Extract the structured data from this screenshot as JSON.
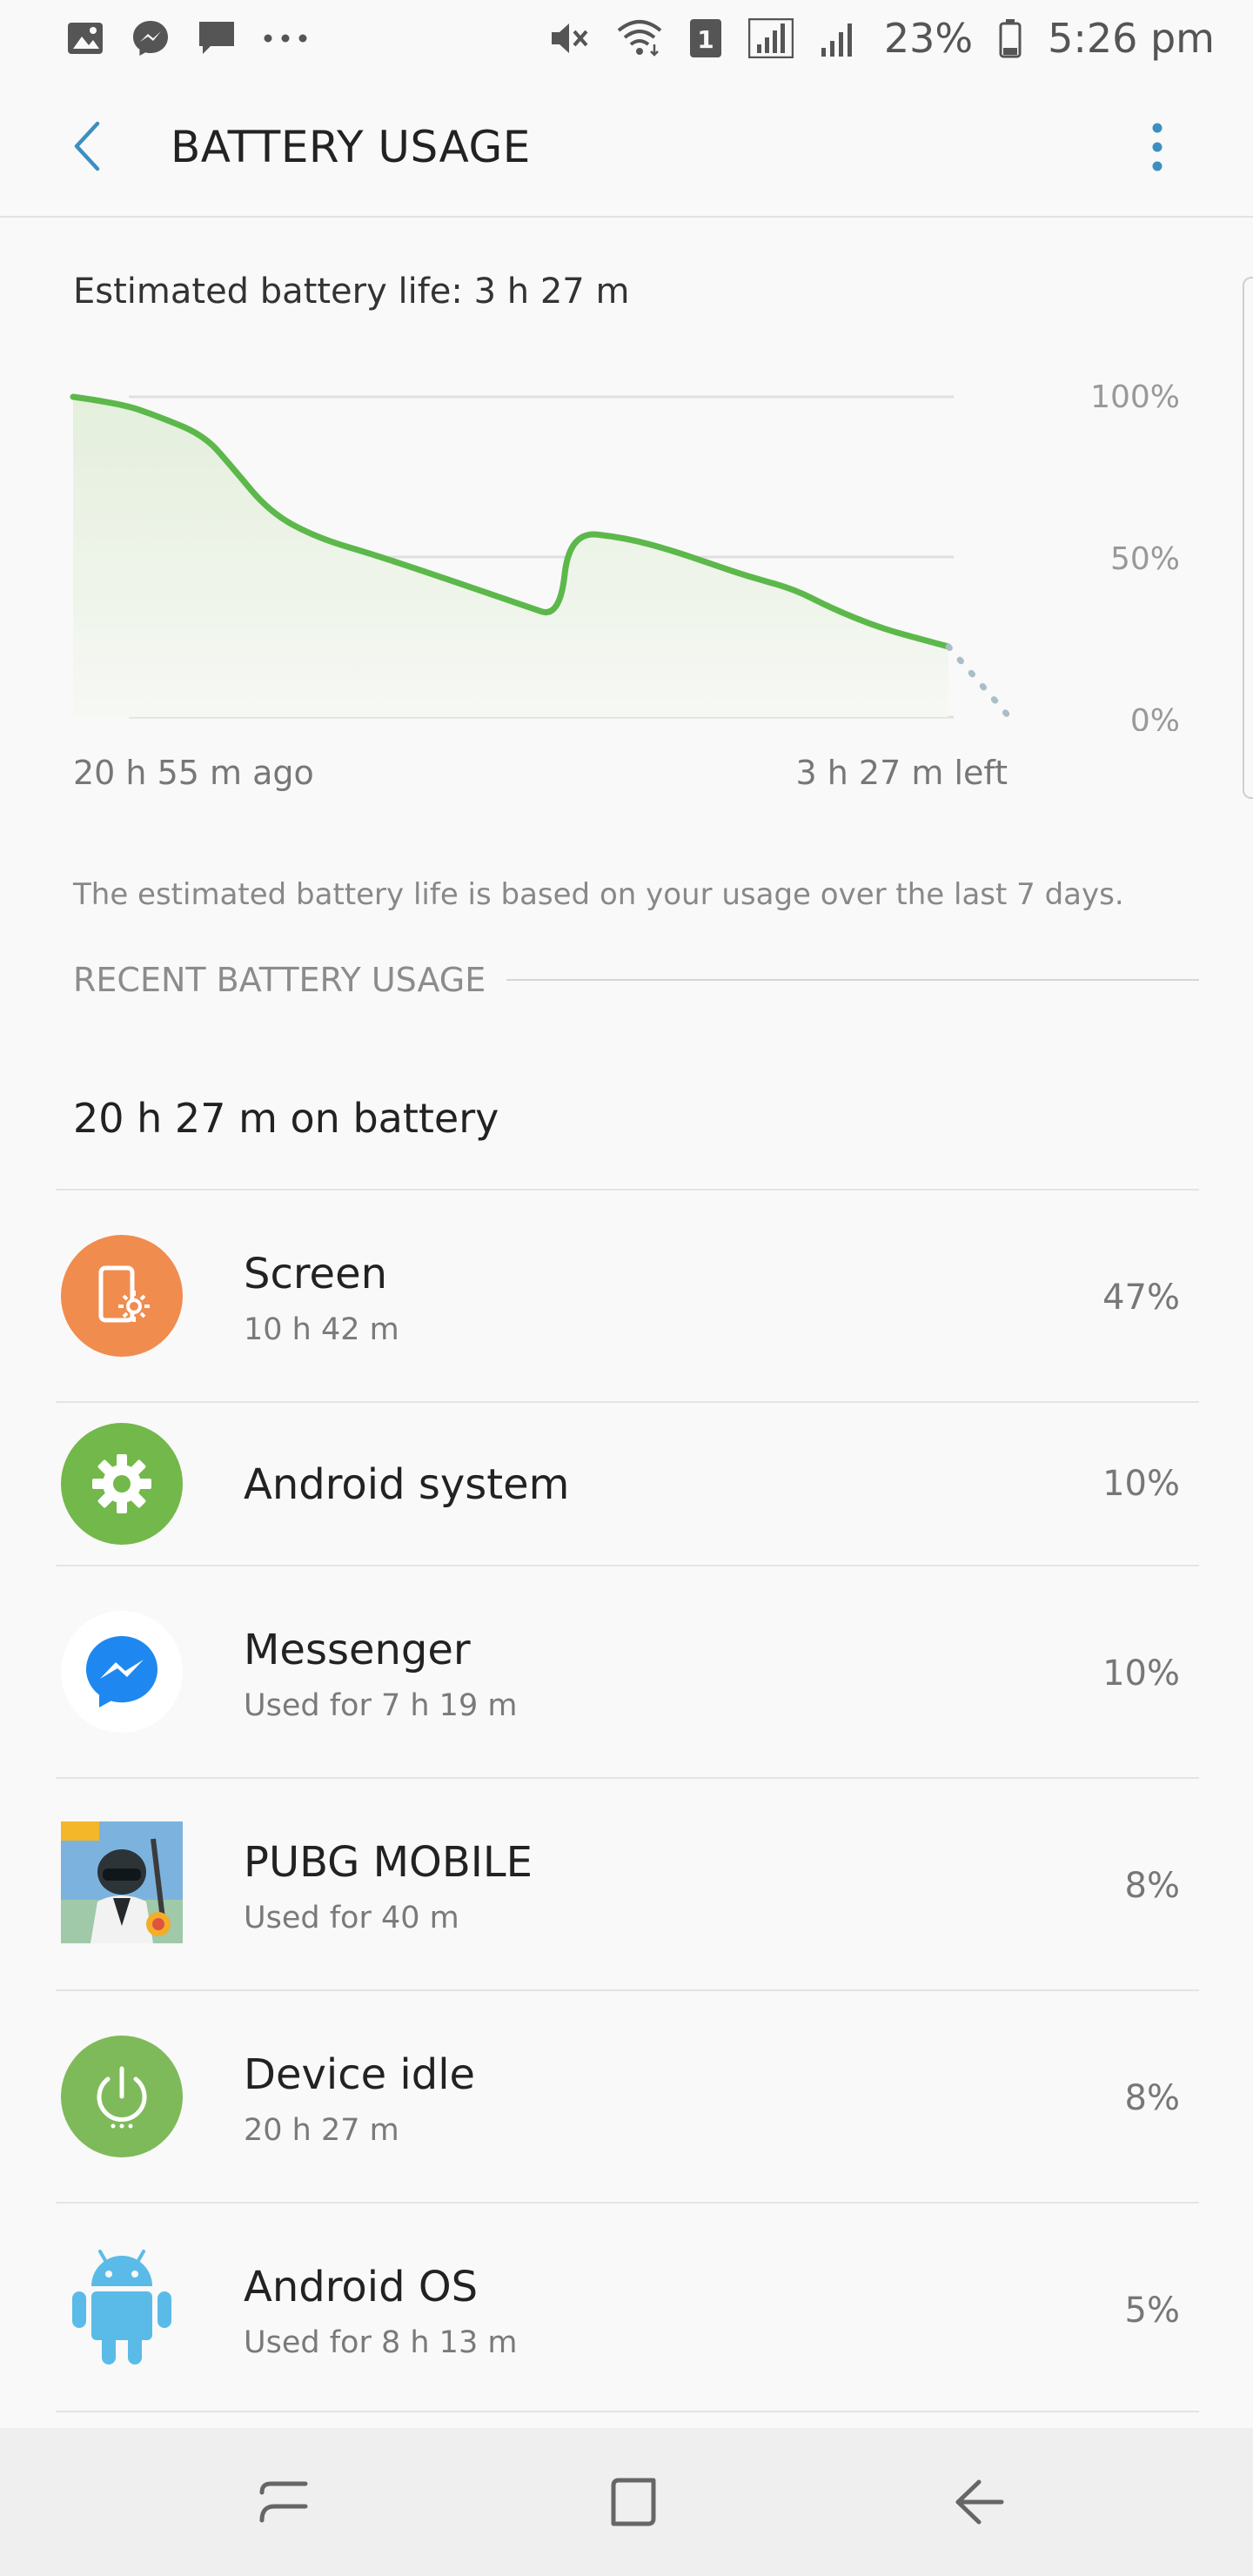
{
  "status_bar": {
    "battery_percent": "23%",
    "time": "5:26 pm",
    "sim_badge": "1",
    "left_icons": [
      "gallery-icon",
      "messenger-icon",
      "chat-icon",
      "more-dots-icon"
    ],
    "right_icons": [
      "mute-icon",
      "wifi-icon",
      "sim-icon",
      "signal-icon",
      "signal-icon",
      "battery-icon"
    ]
  },
  "app_bar": {
    "title": "BATTERY USAGE",
    "back_icon": "back-arrow-icon",
    "more_icon": "more-vert-icon"
  },
  "estimate": "Estimated battery life: 3 h 27 m",
  "chart_data": {
    "type": "line",
    "y_ticks": [
      "100%",
      "50%",
      "0%"
    ],
    "ylim": [
      0,
      100
    ],
    "x_start_label": "20 h 55 m ago",
    "x_end_label": "3 h 27 m left",
    "grid": true,
    "series": [
      {
        "kind": "actual",
        "color": "#5cb84a",
        "points": [
          [
            0,
            100
          ],
          [
            5,
            98
          ],
          [
            9,
            94
          ],
          [
            14,
            88
          ],
          [
            17,
            78
          ],
          [
            21,
            64
          ],
          [
            26,
            56
          ],
          [
            33,
            50
          ],
          [
            48,
            35
          ],
          [
            52,
            31
          ],
          [
            53,
            58
          ],
          [
            59,
            56
          ],
          [
            64,
            52
          ],
          [
            68,
            48
          ],
          [
            72,
            44
          ],
          [
            77,
            40
          ],
          [
            81,
            34
          ],
          [
            86,
            28
          ],
          [
            91,
            24
          ],
          [
            93.5,
            22
          ]
        ]
      },
      {
        "kind": "projected",
        "color": "#a9bec8",
        "points": [
          [
            93.5,
            22
          ],
          [
            100,
            0
          ]
        ]
      }
    ]
  },
  "note": "The estimated battery life is based on your usage over the last 7 days.",
  "section_title": "RECENT BATTERY USAGE",
  "on_battery": "20 h 27 m on battery",
  "items": [
    {
      "name": "Screen",
      "sub": "10 h 42 m",
      "pct": "47%",
      "icon": "screen-brightness-icon",
      "color": "#f08c4e"
    },
    {
      "name": "Android system",
      "sub": "",
      "pct": "10%",
      "icon": "gear-icon",
      "color": "#73b84a"
    },
    {
      "name": "Messenger",
      "sub": "Used for 7 h 19 m",
      "pct": "10%",
      "icon": "messenger-icon",
      "color": "#1e88f0"
    },
    {
      "name": "PUBG MOBILE",
      "sub": "Used for 40 m",
      "pct": "8%",
      "icon": "pubg-app-icon",
      "color": "#3a6ea5"
    },
    {
      "name": "Device idle",
      "sub": "20 h 27 m",
      "pct": "8%",
      "icon": "power-icon",
      "color": "#7fba5a"
    },
    {
      "name": "Android OS",
      "sub": "Used for 8 h 13 m",
      "pct": "5%",
      "icon": "android-icon",
      "color": "#5bbbe8"
    }
  ],
  "nav": {
    "recents_icon": "recents-icon",
    "home_icon": "home-icon",
    "back_icon": "back-icon"
  }
}
